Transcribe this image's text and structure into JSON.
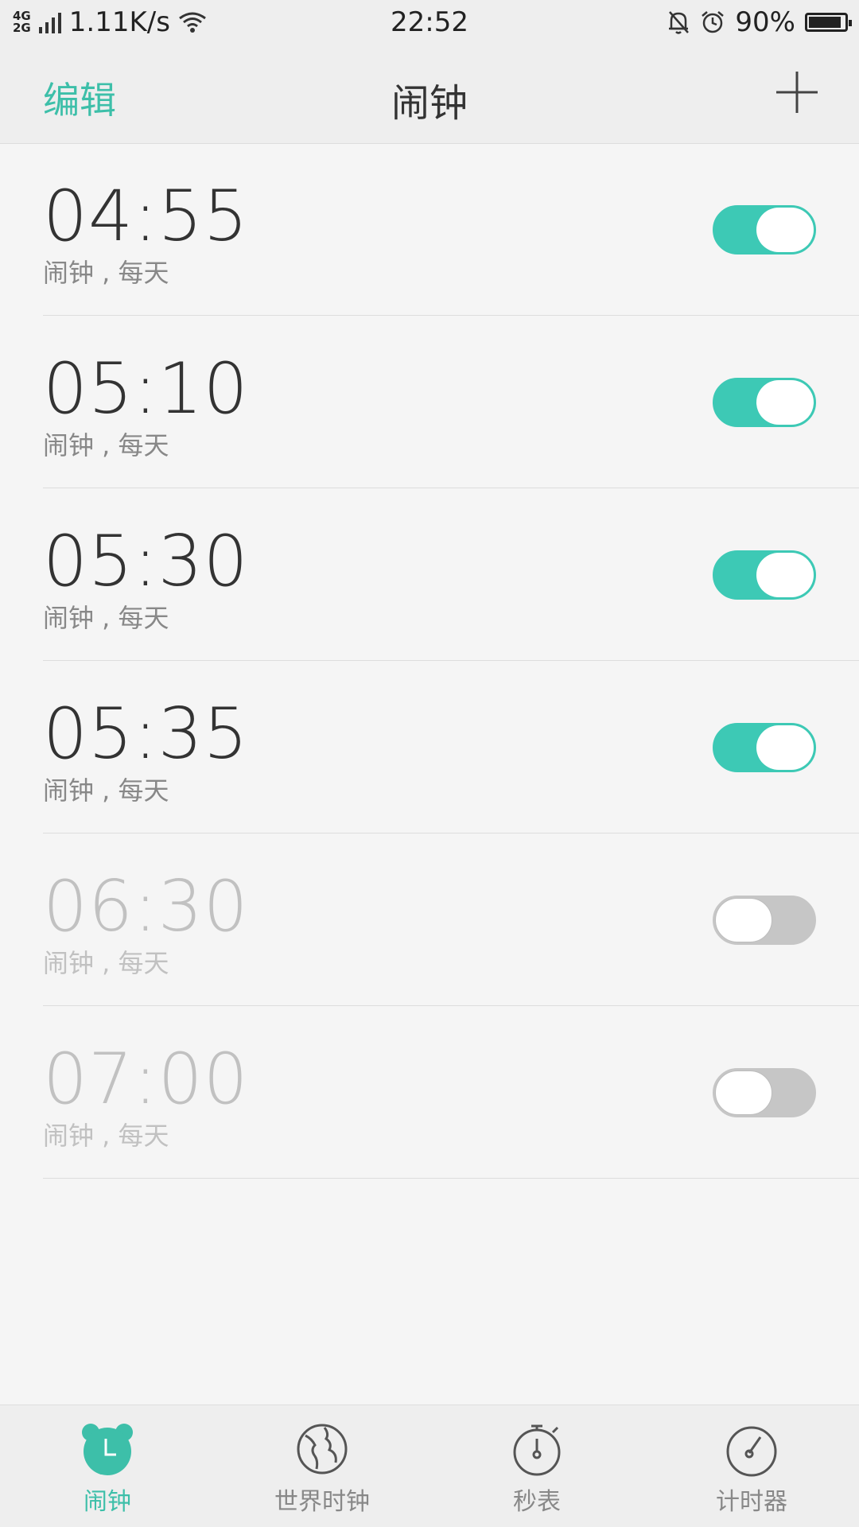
{
  "status_bar": {
    "network_top": "4G",
    "network_bottom": "2G",
    "speed": "1.11K/s",
    "time": "22:52",
    "battery_pct": "90%",
    "battery_level": 0.9
  },
  "header": {
    "edit_label": "编辑",
    "title": "闹钟"
  },
  "alarms": [
    {
      "time": "04:55",
      "label": "闹钟 , 每天",
      "enabled": true
    },
    {
      "time": "05:10",
      "label": "闹钟 , 每天",
      "enabled": true
    },
    {
      "time": "05:30",
      "label": "闹钟 , 每天",
      "enabled": true
    },
    {
      "time": "05:35",
      "label": "闹钟 , 每天",
      "enabled": true
    },
    {
      "time": "06:30",
      "label": "闹钟 , 每天",
      "enabled": false
    },
    {
      "time": "07:00",
      "label": "闹钟 , 每天",
      "enabled": false
    }
  ],
  "tabs": [
    {
      "label": "闹钟",
      "icon": "alarm-clock-icon",
      "active": true
    },
    {
      "label": "世界时钟",
      "icon": "globe-icon",
      "active": false
    },
    {
      "label": "秒表",
      "icon": "stopwatch-icon",
      "active": false
    },
    {
      "label": "计时器",
      "icon": "timer-icon",
      "active": false
    }
  ],
  "colors": {
    "accent": "#3dbfa9",
    "toggle_on": "#3dc9b5",
    "toggle_off": "#c6c6c6"
  }
}
